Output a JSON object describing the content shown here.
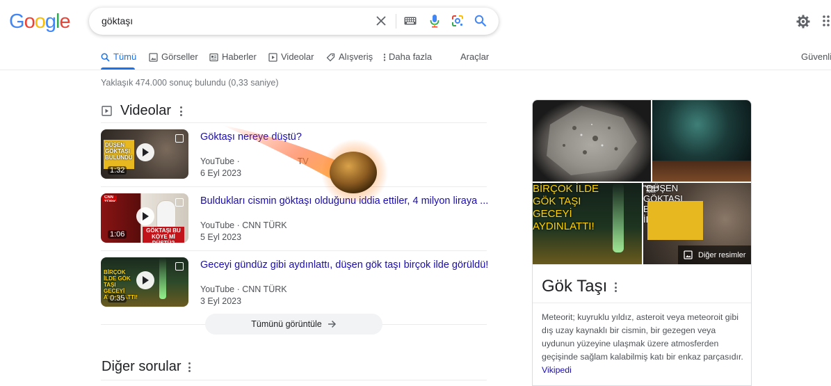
{
  "logo": [
    "G",
    "o",
    "o",
    "g",
    "l",
    "e"
  ],
  "logo_colors": [
    "#4285f4",
    "#ea4335",
    "#fbbc05",
    "#4285f4",
    "#34a853",
    "#ea4335"
  ],
  "search": {
    "query": "göktaşı"
  },
  "icons": {
    "clear": "close-icon",
    "keyboard": "keyboard-icon",
    "voice": "microphone-icon",
    "lens": "lens-icon",
    "search": "search-icon",
    "settings": "gear-icon",
    "apps": "apps-grid-icon"
  },
  "tabs": [
    {
      "label": "Tümü",
      "icon": "search-icon",
      "active": true
    },
    {
      "label": "Görseller",
      "icon": "image-icon"
    },
    {
      "label": "Haberler",
      "icon": "news-icon"
    },
    {
      "label": "Videolar",
      "icon": "video-icon"
    },
    {
      "label": "Alışveriş",
      "icon": "tag-icon"
    },
    {
      "label": "Daha fazla",
      "icon": "more-vert-icon"
    },
    {
      "label": "Araçlar"
    },
    {
      "label": "Güvenli"
    }
  ],
  "result_stats": "Yaklaşık 474.000 sonuç bulundu (0,33 saniye)",
  "videos_section": {
    "title": "Videolar",
    "items": [
      {
        "title": "Göktaşı nereye düştü?",
        "source": "YouTube ·",
        "channel": "TV",
        "date": "6 Eyl 2023",
        "duration": "1:32",
        "thumb_caption": "DÜŞEN GÖKTAŞI BULUNDU"
      },
      {
        "title": "Buldukları cismin göktaşı olduğunu iddia ettiler, 4 milyon liraya ...",
        "source": "YouTube · CNN TÜRK",
        "channel": "",
        "date": "5 Eyl 2023",
        "duration": "1:06",
        "thumb_caption": "GÖKTAŞI BU KÖYE Mİ DÜŞTÜ?",
        "thumb_brand": "CNN TÜRK"
      },
      {
        "title": "Geceyi gündüz gibi aydınlattı, düşen gök taşı birçok ilde görüldü!",
        "source": "YouTube · CNN TÜRK",
        "channel": "",
        "date": "3 Eyl 2023",
        "duration": "0:35",
        "thumb_caption": "BİRÇOK İLDE GÖK TAŞI GECEYİ AYDINLATTI!"
      }
    ],
    "view_all": "Tümünü görüntüle"
  },
  "other_questions": {
    "title": "Diğer sorular"
  },
  "knowledge_panel": {
    "images": [
      {
        "alt": "meteorite-rock",
        "caption": ""
      },
      {
        "alt": "meteor-night-sky",
        "caption": ""
      },
      {
        "alt": "green-meteor-city",
        "caption": "BİRÇOK İLDE GÖK TAŞI GECEYİ AYDINLATTI!"
      },
      {
        "alt": "news-meteor",
        "caption": "\"DÜŞEN GÖKTAŞI BULUNDU\" İDDİASI",
        "brand": "HABER TÜRK"
      }
    ],
    "more_images": "Diğer resimler",
    "title": "Gök Taşı",
    "description": "Meteorit; kuyruklu yıldız, asteroit veya meteoroit gibi dış uzay kaynaklı bir cismin, bir gezegen veya uydunun yüzeyine ulaşmak üzere atmosferden geçişinde sağlam kalabilmiş katı bir enkaz parçasıdır.",
    "source": "Vikipedi"
  }
}
